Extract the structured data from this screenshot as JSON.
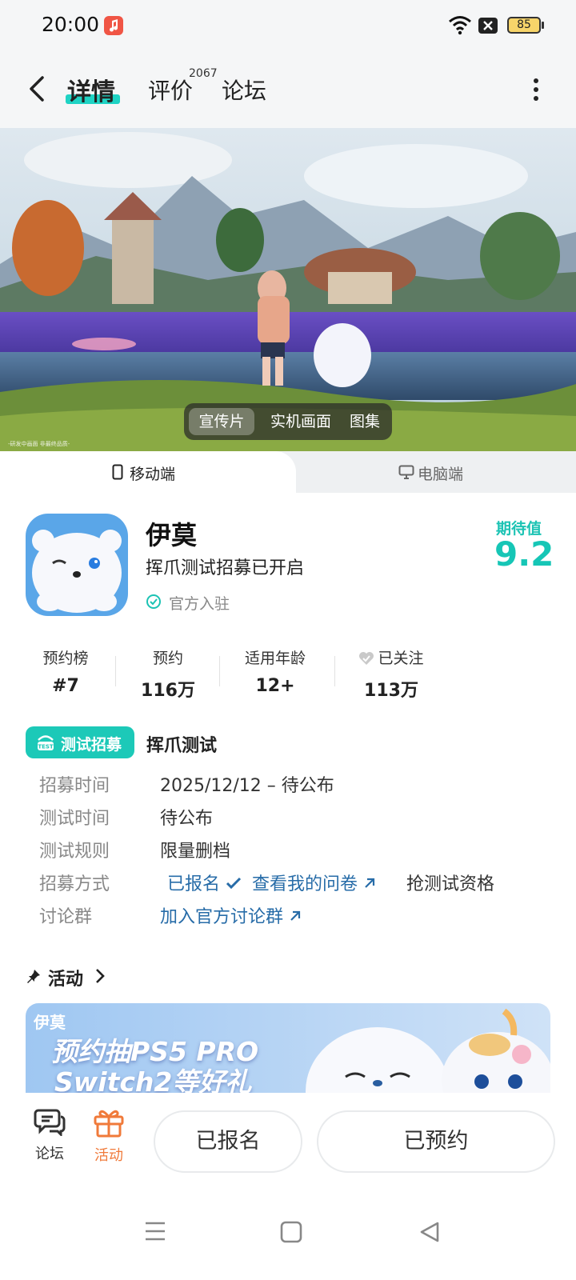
{
  "status_bar": {
    "time": "20:00",
    "battery": "85"
  },
  "header": {
    "tabs": [
      {
        "label": "详情",
        "active": true
      },
      {
        "label": "评价",
        "count": "2067"
      },
      {
        "label": "论坛"
      }
    ]
  },
  "hero": {
    "caption": "-研发中画面 非最终品质-",
    "media_tabs": [
      "宣传片",
      "实机画面",
      "图集"
    ],
    "selected_media": "宣传片"
  },
  "platform_tabs": {
    "mobile": "移动端",
    "pc": "电脑端",
    "selected": "移动端"
  },
  "app": {
    "name": "伊莫",
    "subtitle": "挥爪测试招募已开启",
    "official": "官方入驻",
    "expect_label": "期待值",
    "expect_score": "9.2"
  },
  "stats": [
    {
      "label": "预约榜",
      "value": "#7"
    },
    {
      "label": "预约",
      "value": "116万"
    },
    {
      "label": "适用年龄",
      "value": "12+"
    },
    {
      "label": "已关注",
      "value": "113万"
    }
  ],
  "test": {
    "badge": "测试招募",
    "badge_icon_text": "TEST",
    "title": "挥爪测试",
    "rows": {
      "recruit_time": {
        "label": "招募时间",
        "value": "2025/12/12 – 待公布"
      },
      "test_time": {
        "label": "测试时间",
        "value": "待公布"
      },
      "test_rule": {
        "label": "测试规则",
        "value": "限量删档"
      },
      "recruit_method": {
        "label": "招募方式",
        "signed": "已报名",
        "questionnaire": "查看我的问卷",
        "qualify": "抢测试资格"
      },
      "group": {
        "label": "讨论群",
        "value": "加入官方讨论群"
      }
    }
  },
  "activity": {
    "title": "活动",
    "banner_logo": "伊莫",
    "banner_line1": "预约抽PS5 PRO",
    "banner_line2": "Switch2等好礼"
  },
  "action_bar": {
    "forum": "论坛",
    "activity": "活动",
    "signed_btn": "已报名",
    "reserved_btn": "已预约"
  },
  "colors": {
    "accent": "#1cc9b8",
    "link": "#276ca8",
    "activity": "#f07a3a"
  }
}
